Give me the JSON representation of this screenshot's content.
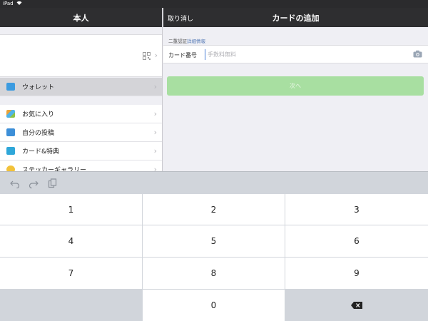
{
  "status_bar": {
    "device": "iPad"
  },
  "left_pane": {
    "title": "本人",
    "items": [
      {
        "label": "ウォレット",
        "icon": "wallet-icon",
        "color": "#3b9be0"
      },
      {
        "label": "お気に入り",
        "icon": "cube-icon",
        "color": "#e8a33a"
      },
      {
        "label": "自分の投稿",
        "icon": "photo-icon",
        "color": "#3d8fd8"
      },
      {
        "label": "カード&特典",
        "icon": "card-icon",
        "color": "#2fa7d9"
      },
      {
        "label": "ステッカーギャラリー",
        "icon": "smile-icon",
        "color": "#f2c23a"
      }
    ]
  },
  "right_pane": {
    "cancel_label": "取り消し",
    "title": "カードの追加",
    "section_note": "二重認証",
    "section_link": "詳細情報",
    "card_number_label": "カード番号",
    "card_number_placeholder": "手数料無料",
    "next_label": "次へ",
    "next_color": "#a8dfa1"
  },
  "keyboard": {
    "keys": [
      "1",
      "2",
      "3",
      "4",
      "5",
      "6",
      "7",
      "8",
      "9",
      "",
      "0",
      "delete"
    ]
  }
}
